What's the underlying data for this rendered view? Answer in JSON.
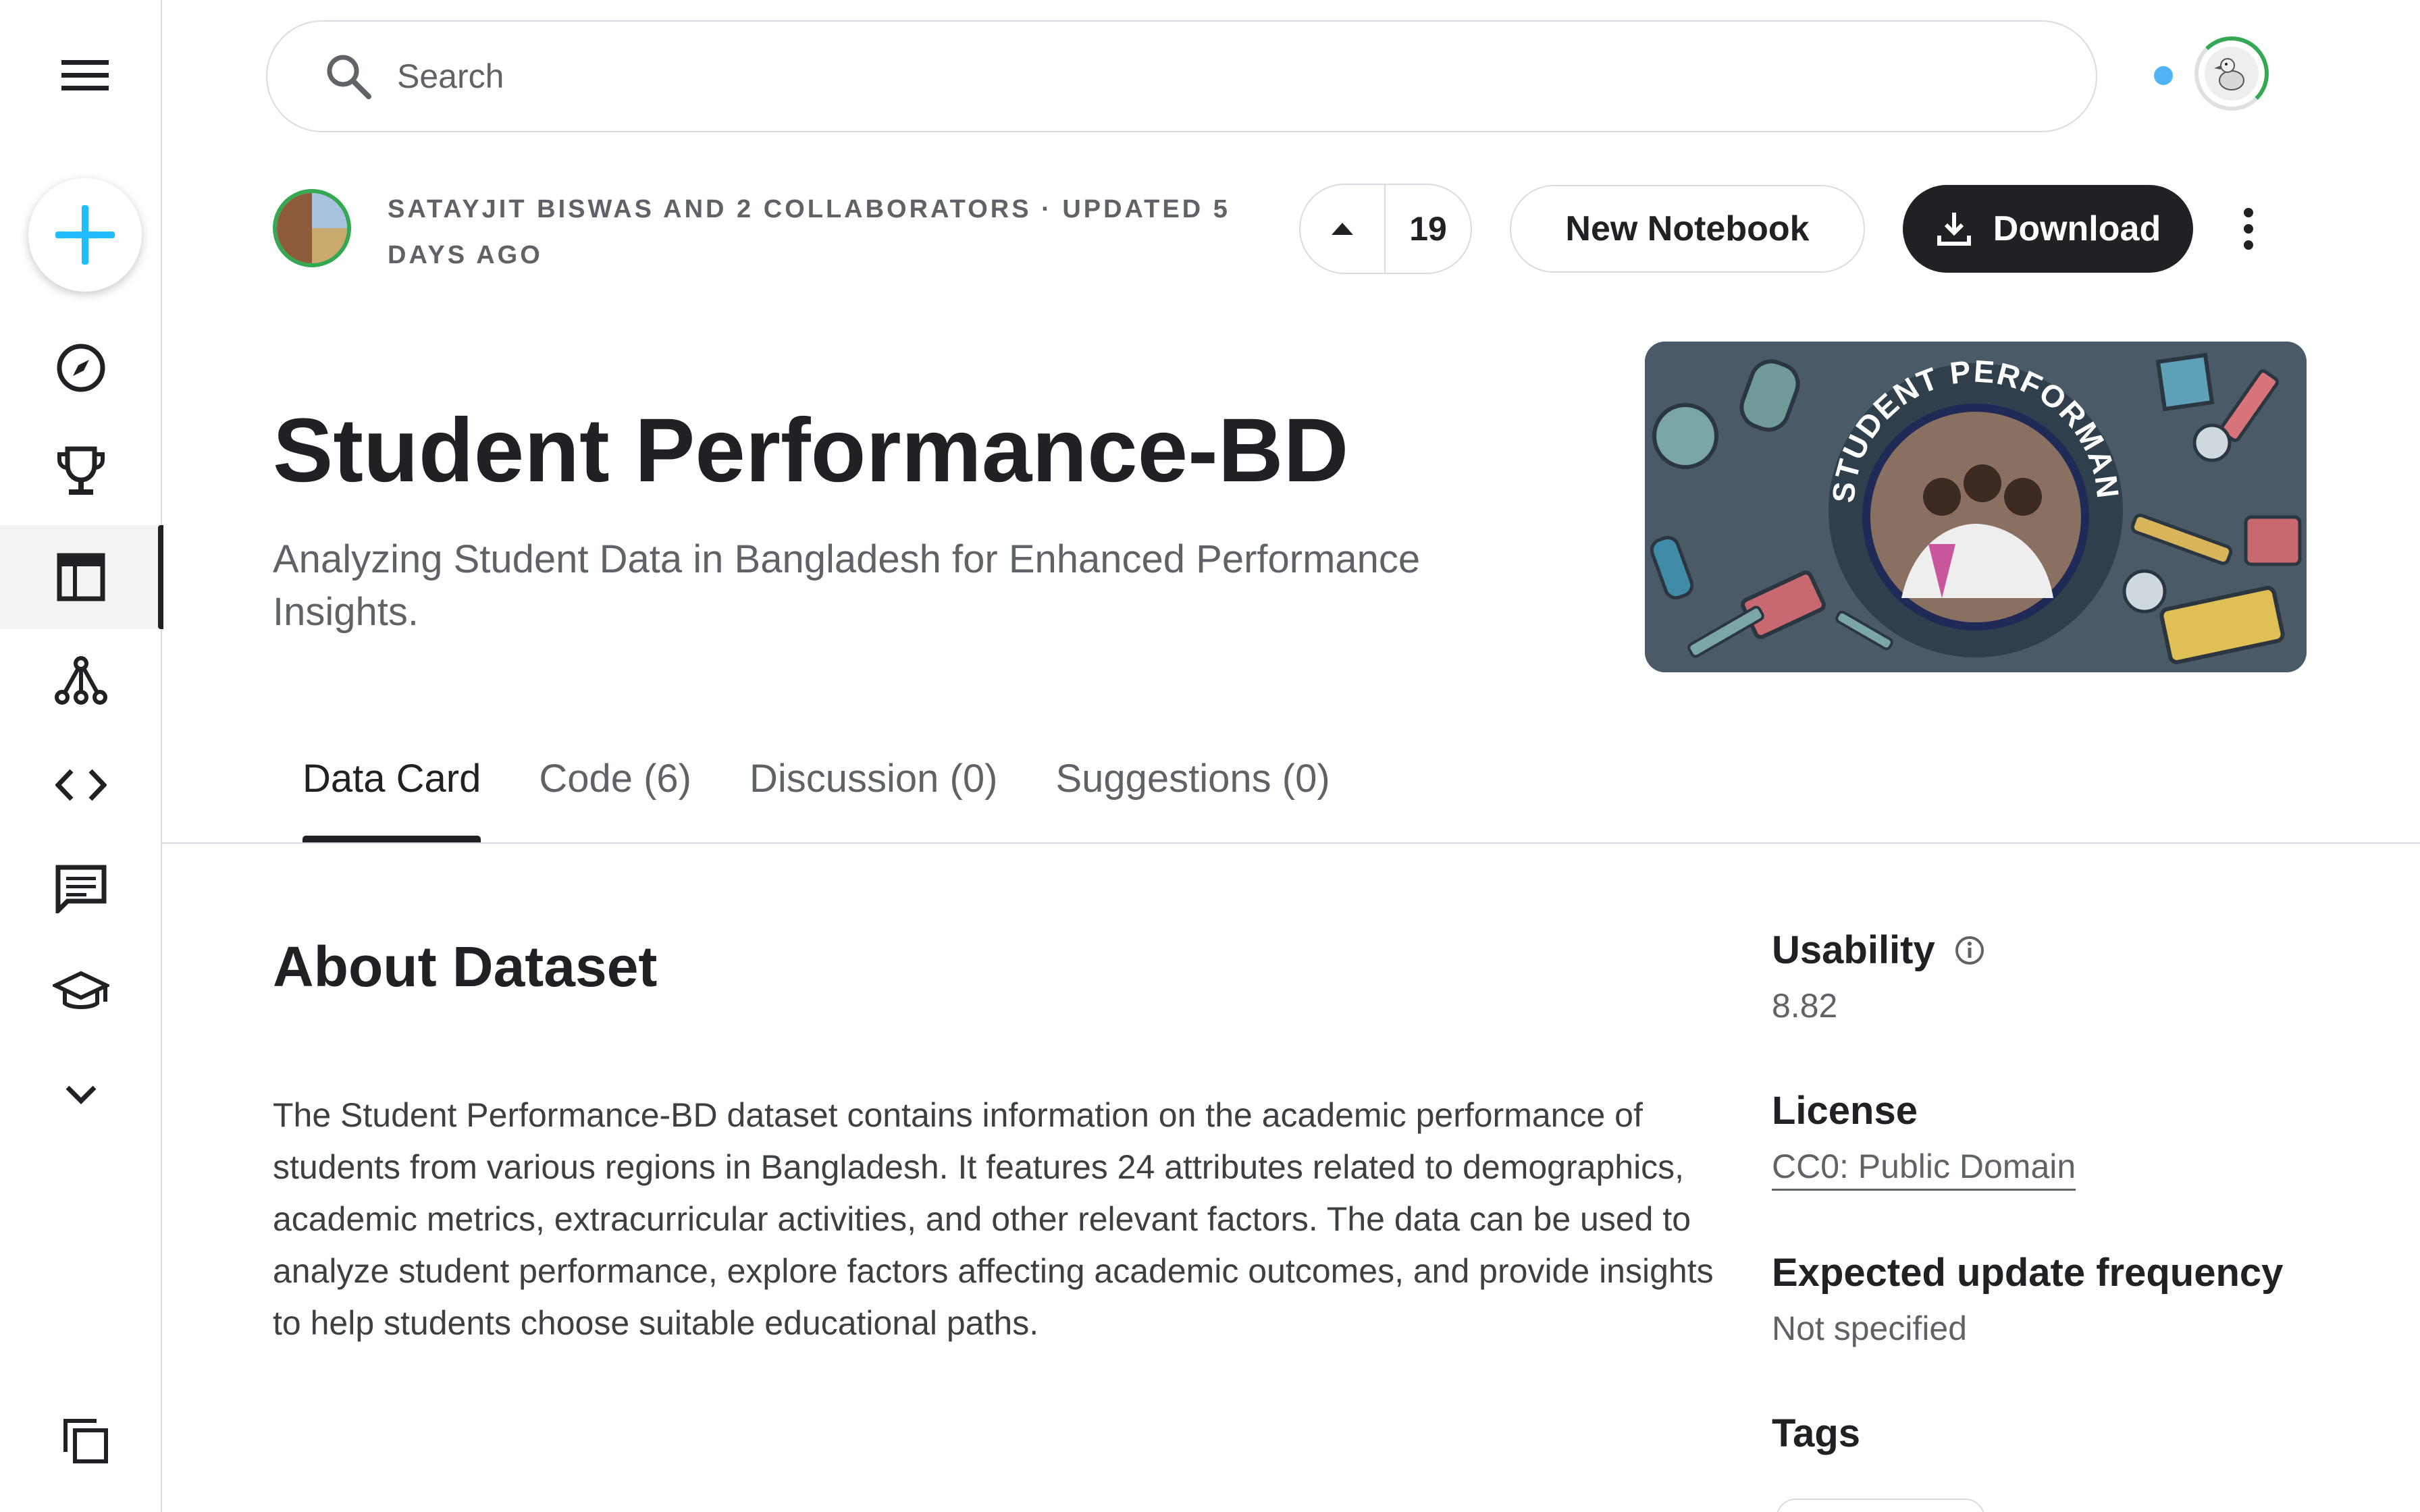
{
  "search": {
    "placeholder": "Search"
  },
  "header": {
    "byline": "Satayjit Biswas and 2 collaborators · Updated 5 days ago",
    "vote_count": "19",
    "new_notebook_label": "New Notebook",
    "download_label": "Download"
  },
  "dataset": {
    "title": "Student Performance-BD",
    "subtitle": "Analyzing Student Data in Bangladesh for Enhanced Performance Insights.",
    "banner_text": "STUDENT PERFORMANCE-BD"
  },
  "tabs": [
    {
      "label": "Data Card",
      "active": true
    },
    {
      "label": "Code (6)",
      "active": false
    },
    {
      "label": "Discussion (0)",
      "active": false
    },
    {
      "label": "Suggestions (0)",
      "active": false
    }
  ],
  "about": {
    "title": "About Dataset",
    "text": "The Student Performance-BD dataset contains information on the academic performance of students from various regions in Bangladesh. It features 24 attributes related to demographics, academic metrics, extracurricular activities, and other relevant factors. The data can be used to analyze student performance, explore factors affecting academic outcomes, and provide insights to help students choose suitable educational paths."
  },
  "meta": {
    "usability_label": "Usability",
    "usability_value": "8.82",
    "license_label": "License",
    "license_value": "CC0: Public Domain",
    "frequency_label": "Expected update frequency",
    "frequency_value": "Not specified",
    "tags_label": "Tags"
  },
  "colors": {
    "accent_blue": "#20beff",
    "dark": "#202124",
    "ring_green": "#34a853",
    "status_dot": "#4fb3f6"
  },
  "icons": {
    "rail": [
      "menu-icon",
      "plus-icon",
      "compass-icon",
      "trophy-icon",
      "table-icon",
      "models-icon",
      "code-icon",
      "discussion-icon",
      "learn-icon",
      "chevron-down-icon",
      "copy-icon"
    ]
  }
}
